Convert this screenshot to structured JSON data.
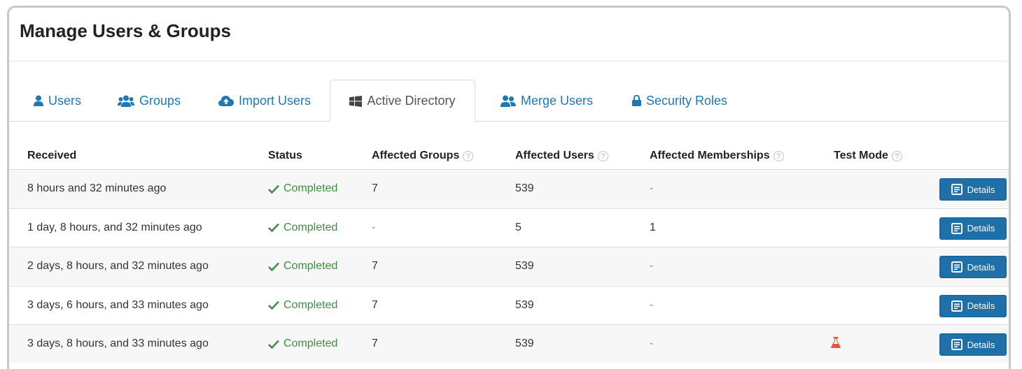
{
  "page": {
    "title": "Manage Users & Groups"
  },
  "tabs": [
    {
      "label": "Users",
      "icon": "user-icon"
    },
    {
      "label": "Groups",
      "icon": "users-group-icon"
    },
    {
      "label": "Import Users",
      "icon": "cloud-upload-icon"
    },
    {
      "label": "Active Directory",
      "icon": "windows-icon",
      "active": true
    },
    {
      "label": "Merge Users",
      "icon": "users-merge-icon"
    },
    {
      "label": "Security Roles",
      "icon": "lock-icon"
    }
  ],
  "table": {
    "headers": {
      "received": "Received",
      "status": "Status",
      "affected_groups": "Affected Groups",
      "affected_users": "Affected Users",
      "affected_memberships": "Affected Memberships",
      "test_mode": "Test Mode"
    },
    "help_glyph": "?",
    "rows": [
      {
        "received": "8 hours and 32 minutes ago",
        "status": "Completed",
        "groups": "7",
        "users": "539",
        "memberships": "-",
        "test_mode": false,
        "action": "Details"
      },
      {
        "received": "1 day, 8 hours, and 32 minutes ago",
        "status": "Completed",
        "groups": "-",
        "users": "5",
        "memberships": "1",
        "test_mode": false,
        "action": "Details"
      },
      {
        "received": "2 days, 8 hours, and 32 minutes ago",
        "status": "Completed",
        "groups": "7",
        "users": "539",
        "memberships": "-",
        "test_mode": false,
        "action": "Details"
      },
      {
        "received": "3 days, 6 hours, and 33 minutes ago",
        "status": "Completed",
        "groups": "7",
        "users": "539",
        "memberships": "-",
        "test_mode": false,
        "action": "Details"
      },
      {
        "received": "3 days, 8 hours, and 33 minutes ago",
        "status": "Completed",
        "groups": "7",
        "users": "539",
        "memberships": "-",
        "test_mode": true,
        "action": "Details"
      }
    ]
  },
  "colors": {
    "link": "#1f78b4",
    "success": "#3e8e3f",
    "button": "#1f6fa8",
    "test_mode_flask": "#e8553a"
  }
}
